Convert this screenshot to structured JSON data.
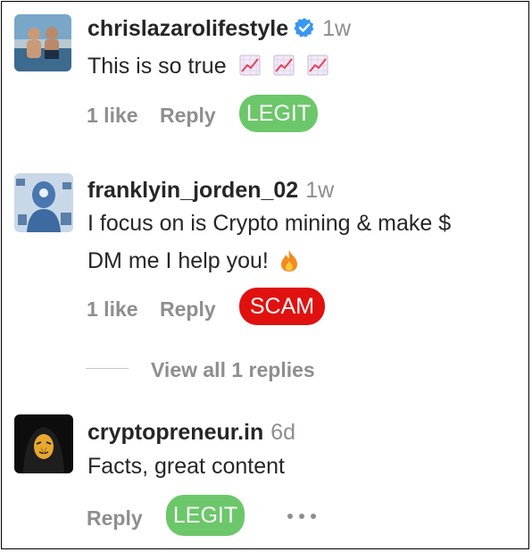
{
  "comments": [
    {
      "username": "chrislazarolifestyle",
      "time": "1w",
      "text": "This is so true",
      "likes": "1 like",
      "reply": "Reply",
      "tag": "LEGIT",
      "emoji": "chart-increasing-icon",
      "verified": true
    },
    {
      "username": "franklyin_jorden_02",
      "time": "1w",
      "text_line1": "I focus on is Crypto mining & make $",
      "text_line2": "DM me I help you!",
      "likes": "1 like",
      "reply": "Reply",
      "tag": "SCAM",
      "emoji": "fire-icon",
      "view_replies": "View all 1 replies"
    },
    {
      "username": "cryptopreneur.in",
      "time": "6d",
      "text": "Facts, great content",
      "reply": "Reply",
      "tag": "LEGIT",
      "more": "more-options-icon"
    }
  ],
  "colors": {
    "legit": "#6cc76a",
    "scam": "#e0110f",
    "verified": "#3897f0",
    "meta": "#8e8e8e"
  }
}
